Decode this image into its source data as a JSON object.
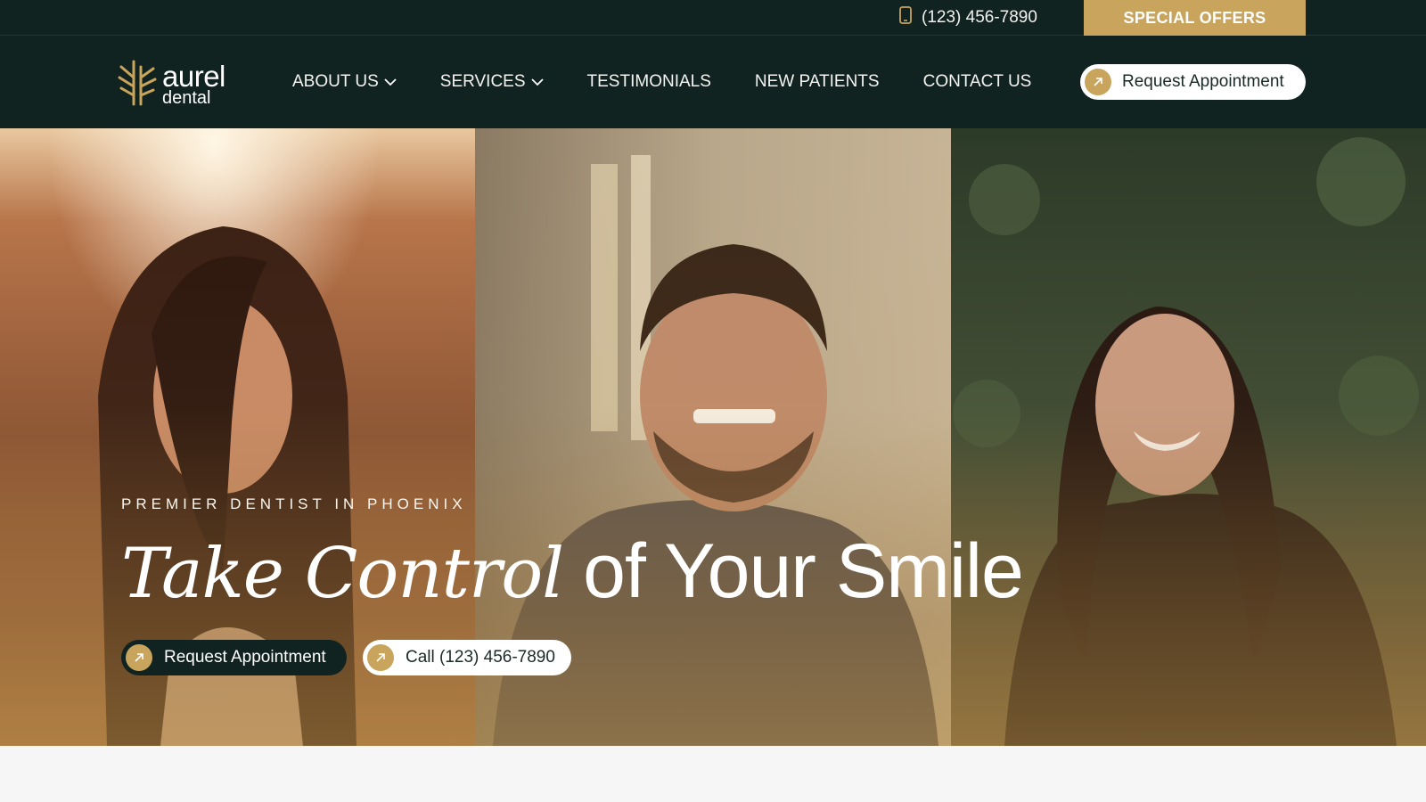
{
  "topbar": {
    "phone": "(123) 456-7890",
    "special_offers": "SPECIAL OFFERS",
    "phone_icon": "mobile-phone-icon"
  },
  "brand": {
    "name_line1": "aurel",
    "name_line2": "dental",
    "logo_icon": "wheat-leaf-logo-icon"
  },
  "nav": {
    "items": [
      {
        "label": "ABOUT US",
        "has_dropdown": true
      },
      {
        "label": "SERVICES",
        "has_dropdown": true
      },
      {
        "label": "TESTIMONIALS",
        "has_dropdown": false
      },
      {
        "label": "NEW PATIENTS",
        "has_dropdown": false
      },
      {
        "label": "CONTACT US",
        "has_dropdown": false
      }
    ],
    "cta_label": "Request Appointment"
  },
  "hero": {
    "eyebrow": "PREMIER DENTIST IN PHOENIX",
    "headline_italic": "Take Control",
    "headline_rest": "of Your Smile",
    "primary_btn": "Request Appointment",
    "secondary_btn": "Call (123) 456-7890"
  },
  "colors": {
    "dark_green": "#112320",
    "gold": "#c8a45c",
    "white": "#ffffff"
  }
}
